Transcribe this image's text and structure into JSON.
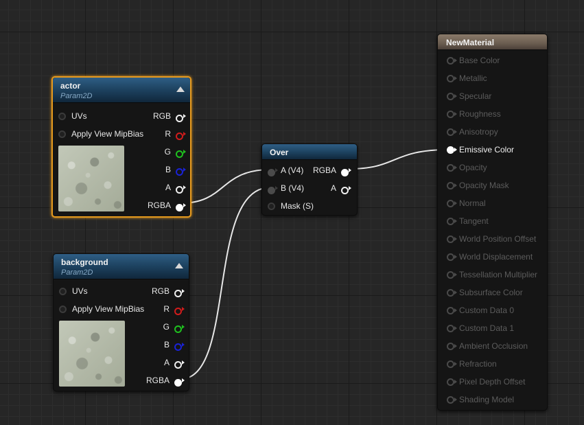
{
  "nodes": {
    "actor": {
      "title": "actor",
      "subtitle": "Param2D",
      "inputs": [
        "UVs",
        "Apply View MipBias"
      ],
      "outputs": [
        "RGB",
        "R",
        "G",
        "B",
        "A",
        "RGBA"
      ]
    },
    "background": {
      "title": "background",
      "subtitle": "Param2D",
      "inputs": [
        "UVs",
        "Apply View MipBias"
      ],
      "outputs": [
        "RGB",
        "R",
        "G",
        "B",
        "A",
        "RGBA"
      ]
    },
    "over": {
      "title": "Over",
      "inputs": [
        "A (V4)",
        "B (V4)",
        "Mask (S)"
      ],
      "outputs": [
        "RGBA",
        "A"
      ]
    },
    "material": {
      "title": "NewMaterial",
      "inputs": [
        "Base Color",
        "Metallic",
        "Specular",
        "Roughness",
        "Anisotropy",
        "Emissive Color",
        "Opacity",
        "Opacity Mask",
        "Normal",
        "Tangent",
        "World Position Offset",
        "World Displacement",
        "Tessellation Multiplier",
        "Subsurface Color",
        "Custom Data 0",
        "Custom Data 1",
        "Ambient Occlusion",
        "Refraction",
        "Pixel Depth Offset",
        "Shading Model"
      ],
      "active_input": "Emissive Color"
    }
  },
  "colors": {
    "background": "#262626",
    "selection": "#e69a1e",
    "header_blue": "#1e4462",
    "header_material": "#6b5d50",
    "pin_red": "#d21c1c",
    "pin_green": "#1fc21f",
    "pin_blue": "#1a22d6",
    "wire": "#e8e8e8"
  },
  "icons": [
    "collapse-arrow-icon",
    "pin-icon",
    "texture-preview"
  ]
}
